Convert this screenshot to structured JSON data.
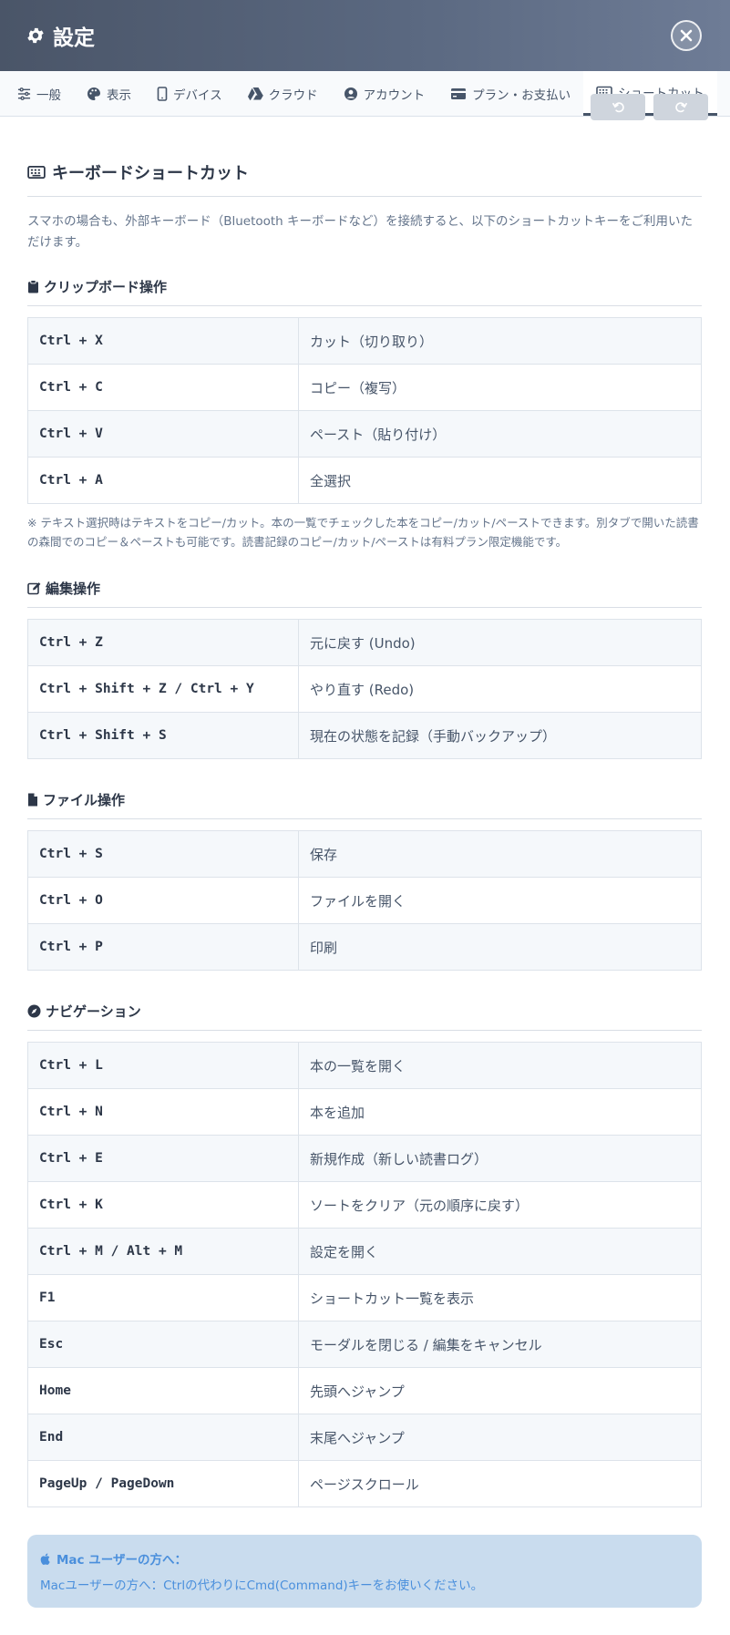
{
  "header": {
    "title": "設定",
    "close_label": "close"
  },
  "tabs": [
    {
      "label": "一般",
      "icon": "sliders-icon",
      "active": false
    },
    {
      "label": "表示",
      "icon": "palette-icon",
      "active": false
    },
    {
      "label": "デバイス",
      "icon": "mobile-icon",
      "active": false
    },
    {
      "label": "クラウド",
      "icon": "google-drive-icon",
      "active": false
    },
    {
      "label": "アカウント",
      "icon": "user-circle-icon",
      "active": false
    },
    {
      "label": "プラン・お支払い",
      "icon": "credit-card-icon",
      "active": false
    },
    {
      "label": "ショートカット",
      "icon": "keyboard-icon",
      "active": true
    }
  ],
  "main": {
    "title": "キーボードショートカット",
    "description": "スマホの場合も、外部キーボード（Bluetooth キーボードなど）を接続すると、以下のショートカットキーをご利用いただけます。"
  },
  "clipboard": {
    "title": "クリップボード操作",
    "rows": [
      {
        "key": "Ctrl + X",
        "action": "カット（切り取り）"
      },
      {
        "key": "Ctrl + C",
        "action": "コピー（複写）"
      },
      {
        "key": "Ctrl + V",
        "action": "ペースト（貼り付け）"
      },
      {
        "key": "Ctrl + A",
        "action": "全選択"
      }
    ],
    "note": "※ テキスト選択時はテキストをコピー/カット。本の一覧でチェックした本をコピー/カット/ペーストできます。別タブで開いた読書の森間でのコピー＆ペーストも可能です。読書記録のコピー/カット/ペーストは有料プラン限定機能です。"
  },
  "edit": {
    "title": "編集操作",
    "rows": [
      {
        "key": "Ctrl + Z",
        "action": "元に戻す (Undo)"
      },
      {
        "key": "Ctrl + Shift + Z / Ctrl + Y",
        "action": "やり直す (Redo)"
      },
      {
        "key": "Ctrl + Shift + S",
        "action": "現在の状態を記録（手動バックアップ）"
      }
    ]
  },
  "file": {
    "title": "ファイル操作",
    "rows": [
      {
        "key": "Ctrl + S",
        "action": "保存"
      },
      {
        "key": "Ctrl + O",
        "action": "ファイルを開く"
      },
      {
        "key": "Ctrl + P",
        "action": "印刷"
      }
    ]
  },
  "nav": {
    "title": "ナビゲーション",
    "rows": [
      {
        "key": "Ctrl + L",
        "action": "本の一覧を開く"
      },
      {
        "key": "Ctrl + N",
        "action": "本を追加"
      },
      {
        "key": "Ctrl + E",
        "action": "新規作成（新しい読書ログ）"
      },
      {
        "key": "Ctrl + K",
        "action": "ソートをクリア（元の順序に戻す）"
      },
      {
        "key": "Ctrl + M / Alt + M",
        "action": "設定を開く"
      },
      {
        "key": "F1",
        "action": "ショートカット一覧を表示"
      },
      {
        "key": "Esc",
        "action": "モーダルを閉じる / 編集をキャンセル"
      },
      {
        "key": "Home",
        "action": "先頭へジャンプ"
      },
      {
        "key": "End",
        "action": "末尾へジャンプ"
      },
      {
        "key": "PageUp / PageDown",
        "action": "ページスクロール"
      }
    ]
  },
  "mac": {
    "title": "Mac ユーザーの方へ：",
    "text": "Macユーザーの方へ：Ctrlの代わりにCmd(Command)キーをお使いください。"
  },
  "colors": {
    "header": "#4a5568",
    "accent": "#4a8fdc",
    "info_bg": "#c9dcee"
  }
}
